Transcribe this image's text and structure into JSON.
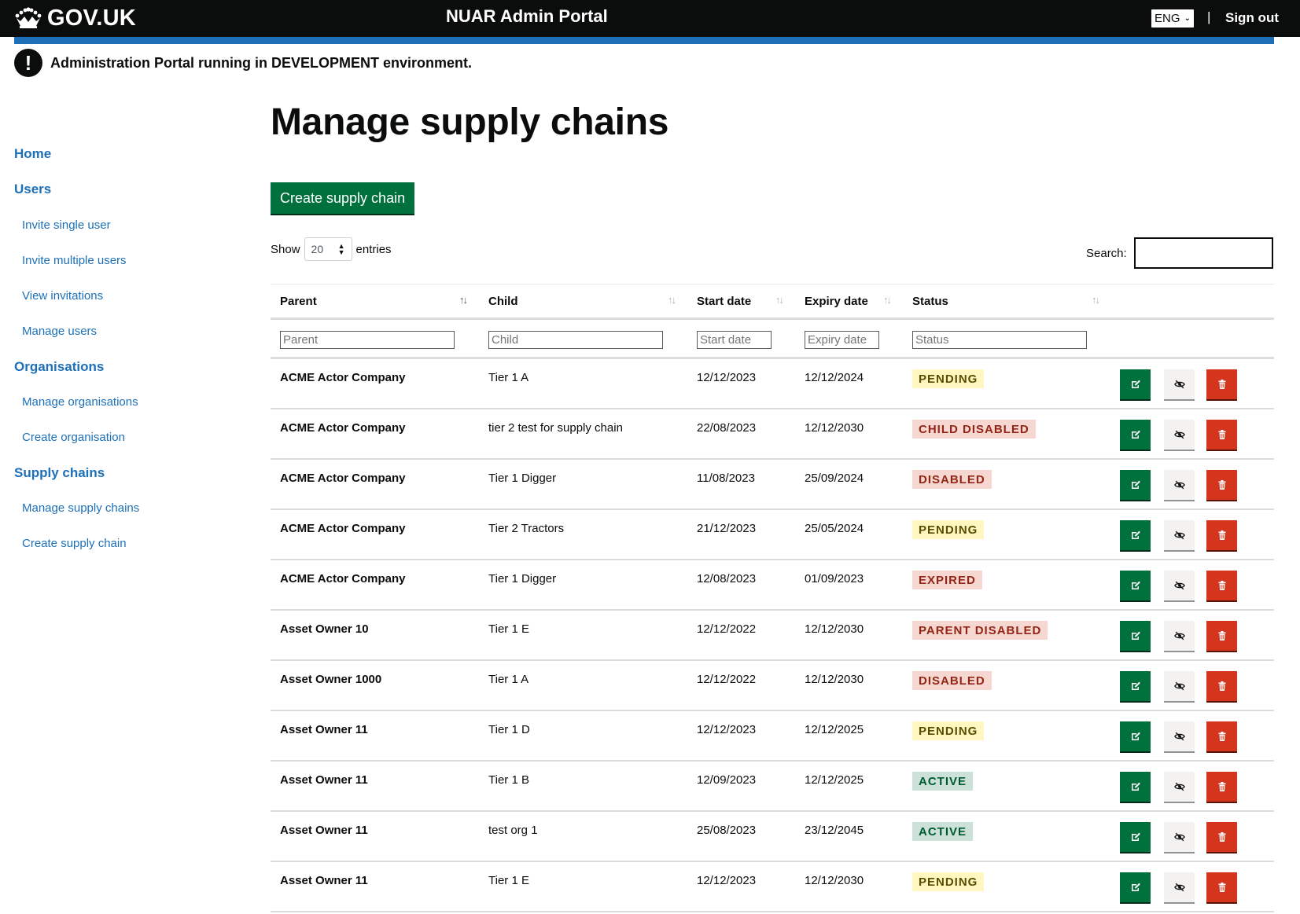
{
  "header": {
    "logo_text": "GOV.UK",
    "service_name": "NUAR Admin Portal",
    "language": "ENG",
    "divider": "|",
    "sign_out": "Sign out"
  },
  "warning": {
    "icon": "!",
    "text": "Administration Portal running in DEVELOPMENT environment."
  },
  "sidebar": {
    "home": "Home",
    "users": "Users",
    "invite_single_user": "Invite single user",
    "invite_multiple_users": "Invite multiple users",
    "view_invitations": "View invitations",
    "manage_users": "Manage users",
    "organisations": "Organisations",
    "manage_organisations": "Manage organisations",
    "create_organisation": "Create organisation",
    "supply_chains": "Supply chains",
    "manage_supply_chains": "Manage supply chains",
    "create_supply_chain": "Create supply chain"
  },
  "main": {
    "title": "Manage supply chains",
    "create_button": "Create supply chain",
    "show_label": "Show",
    "page_length": "20",
    "entries_label": "entries",
    "search_label": "Search:"
  },
  "table": {
    "columns": [
      "Parent",
      "Child",
      "Start date",
      "Expiry date",
      "Status"
    ],
    "filters": [
      "Parent",
      "Child",
      "Start date",
      "Expiry date",
      "Status"
    ],
    "rows": [
      {
        "parent": "ACME Actor Company",
        "child": "Tier 1 A",
        "start": "12/12/2023",
        "expiry": "12/12/2024",
        "status": "PENDING"
      },
      {
        "parent": "ACME Actor Company",
        "child": "tier 2 test for supply chain",
        "start": "22/08/2023",
        "expiry": "12/12/2030",
        "status": "CHILD DISABLED"
      },
      {
        "parent": "ACME Actor Company",
        "child": "Tier 1 Digger",
        "start": "11/08/2023",
        "expiry": "25/09/2024",
        "status": "DISABLED"
      },
      {
        "parent": "ACME Actor Company",
        "child": "Tier 2 Tractors",
        "start": "21/12/2023",
        "expiry": "25/05/2024",
        "status": "PENDING"
      },
      {
        "parent": "ACME Actor Company",
        "child": "Tier 1 Digger",
        "start": "12/08/2023",
        "expiry": "01/09/2023",
        "status": "EXPIRED"
      },
      {
        "parent": "Asset Owner 10",
        "child": "Tier 1 E",
        "start": "12/12/2022",
        "expiry": "12/12/2030",
        "status": "PARENT DISABLED"
      },
      {
        "parent": "Asset Owner 1000",
        "child": "Tier 1 A",
        "start": "12/12/2022",
        "expiry": "12/12/2030",
        "status": "DISABLED"
      },
      {
        "parent": "Asset Owner 11",
        "child": "Tier 1 D",
        "start": "12/12/2023",
        "expiry": "12/12/2025",
        "status": "PENDING"
      },
      {
        "parent": "Asset Owner 11",
        "child": "Tier 1 B",
        "start": "12/09/2023",
        "expiry": "12/12/2025",
        "status": "ACTIVE"
      },
      {
        "parent": "Asset Owner 11",
        "child": "test org 1",
        "start": "25/08/2023",
        "expiry": "23/12/2045",
        "status": "ACTIVE"
      },
      {
        "parent": "Asset Owner 11",
        "child": "Tier 1 E",
        "start": "12/12/2023",
        "expiry": "12/12/2030",
        "status": "PENDING"
      }
    ]
  },
  "colors": {
    "header_bg": "#0b0c0c",
    "brand_blue": "#1d70b8",
    "button_green": "#00703c",
    "delete_red": "#d4351c",
    "tag_pending_bg": "#fff7bf",
    "tag_disabled_bg": "#f6d7d2",
    "tag_active_bg": "#cce2d8"
  },
  "icons": {
    "logo": "crown-icon",
    "edit": "edit-icon",
    "hide": "eye-slash-icon",
    "delete": "trash-icon",
    "sort": "sort-arrows-icon"
  }
}
